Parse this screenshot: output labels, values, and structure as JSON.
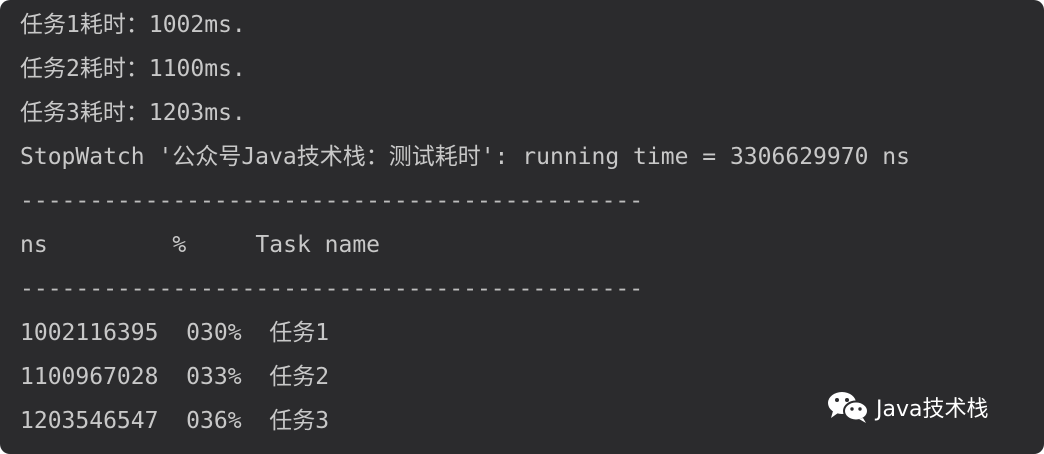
{
  "console": {
    "lines": [
      "任务1耗时：1002ms.",
      "任务2耗时：1100ms.",
      "任务3耗时：1203ms.",
      "StopWatch '公众号Java技术栈：测试耗时': running time = 3306629970 ns",
      "---------------------------------------------",
      "ns         %     Task name",
      "---------------------------------------------",
      "1002116395  030%  任务1",
      "1100967028  033%  任务2",
      "1203546547  036%  任务3"
    ]
  },
  "watermark": {
    "icon": "wechat-icon",
    "text": "Java技术栈"
  }
}
